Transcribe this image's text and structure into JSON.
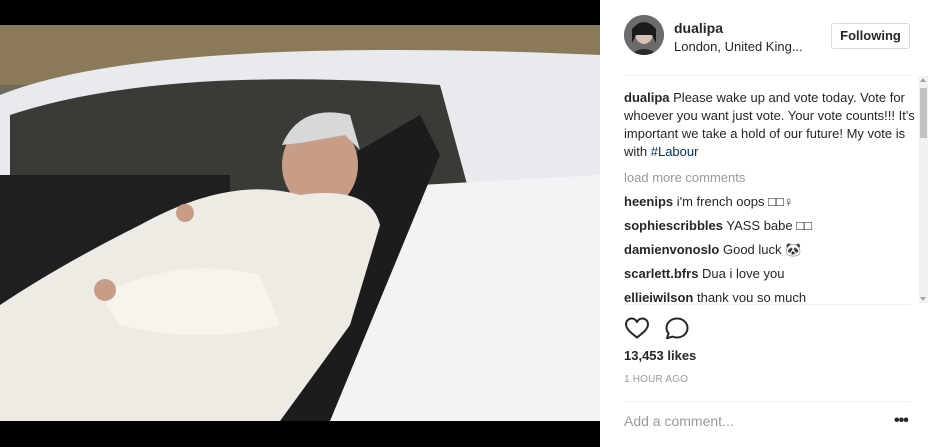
{
  "post": {
    "username": "dualipa",
    "location": "London, United King...",
    "follow_label": "Following",
    "caption_user": "dualipa",
    "caption_text": "Please wake up and vote today. Vote for whoever you want just vote. Your vote counts!!! It's important we take a hold of our future! My vote is with ",
    "caption_hashtag": "#Labour",
    "load_more": "load more comments",
    "comments": [
      {
        "user": "heenips",
        "text": "i'm french oops □□♀"
      },
      {
        "user": "sophiescribbles",
        "text": "YASS babe □□"
      },
      {
        "user": "damienvonoslo",
        "text": "Good luck 🐼"
      },
      {
        "user": "scarlett.bfrs",
        "text": "Dua i love you"
      },
      {
        "user": "elliejwilson",
        "text": "thank you so much"
      }
    ],
    "likes": "13,453 likes",
    "time": "1 HOUR AGO",
    "add_comment_placeholder": "Add a comment...",
    "more_label": "•••",
    "icons": [
      "heart-icon",
      "comment-icon",
      "more-options-icon"
    ]
  }
}
